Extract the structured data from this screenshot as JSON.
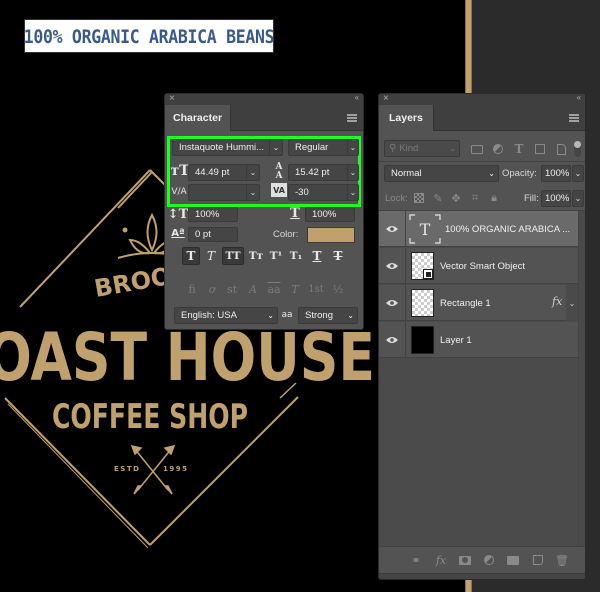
{
  "canvas": {
    "caption_text": "100% ORGANIC ARABICA BEANS",
    "logo": {
      "line1": "BROOKLYN",
      "line2": "ROAST HOUSE",
      "line3": "COFFEE SHOP",
      "estd_left": "ESTD",
      "estd_right": "1995"
    },
    "colors": {
      "gold": "#c0a06d",
      "caption_text": "#3a5a8e",
      "highlight": "#1dff1d"
    }
  },
  "character_panel": {
    "close_icon": "×",
    "collapse_icon": "‹‹",
    "tab_label": "Character",
    "font_family": "Instaquote Hummi...",
    "font_style": "Regular",
    "font_size": "44.49 pt",
    "leading": "15.42 pt",
    "kerning": "",
    "tracking": "-30",
    "vertical_scale": "100%",
    "horizontal_scale": "100%",
    "baseline_shift": "0 pt",
    "color_label": "Color:",
    "color_value": "#c0a06d",
    "style_buttons": [
      {
        "name": "faux-bold",
        "glyph": "T",
        "active": true
      },
      {
        "name": "faux-italic",
        "glyph": "T",
        "active": false
      },
      {
        "name": "all-caps",
        "glyph": "TT",
        "active": true
      },
      {
        "name": "small-caps",
        "glyph": "Tт",
        "active": false
      },
      {
        "name": "superscript",
        "glyph": "T¹",
        "active": false
      },
      {
        "name": "subscript",
        "glyph": "T₁",
        "active": false
      },
      {
        "name": "underline",
        "glyph": "T",
        "active": false
      },
      {
        "name": "strikethrough",
        "glyph": "T",
        "active": false
      }
    ],
    "opentype_buttons": [
      {
        "name": "standard-ligatures",
        "glyph": "fi"
      },
      {
        "name": "contextual-alternates",
        "glyph": "ơ"
      },
      {
        "name": "discretionary-ligatures",
        "glyph": "st"
      },
      {
        "name": "swash",
        "glyph": "A"
      },
      {
        "name": "stylistic-alternates",
        "glyph": "aa"
      },
      {
        "name": "titling-alternates",
        "glyph": "T"
      },
      {
        "name": "ordinals",
        "glyph": "1st"
      },
      {
        "name": "fractions",
        "glyph": "½"
      }
    ],
    "language": "English: USA",
    "antialias_icon": "aa",
    "antialias": "Strong",
    "chevron": "⌄"
  },
  "layers_panel": {
    "close_icon": "×",
    "collapse_icon": "‹‹",
    "tab_label": "Layers",
    "filter_kind": "Kind",
    "blend_mode": "Normal",
    "opacity_label": "Opacity:",
    "opacity": "100%",
    "lock_label": "Lock:",
    "fill_label": "Fill:",
    "fill": "100%",
    "chevron": "⌄",
    "layers": [
      {
        "name": "100% ORGANIC ARABICA ...",
        "type": "text",
        "selected": true,
        "visible": true
      },
      {
        "name": "Vector Smart Object",
        "type": "smart-object",
        "selected": false,
        "visible": true
      },
      {
        "name": "Rectangle 1",
        "type": "shape",
        "selected": false,
        "visible": true,
        "fx": "fx"
      },
      {
        "name": "Layer 1",
        "type": "pixel",
        "selected": false,
        "visible": true
      }
    ],
    "footer_fx": "fx"
  }
}
